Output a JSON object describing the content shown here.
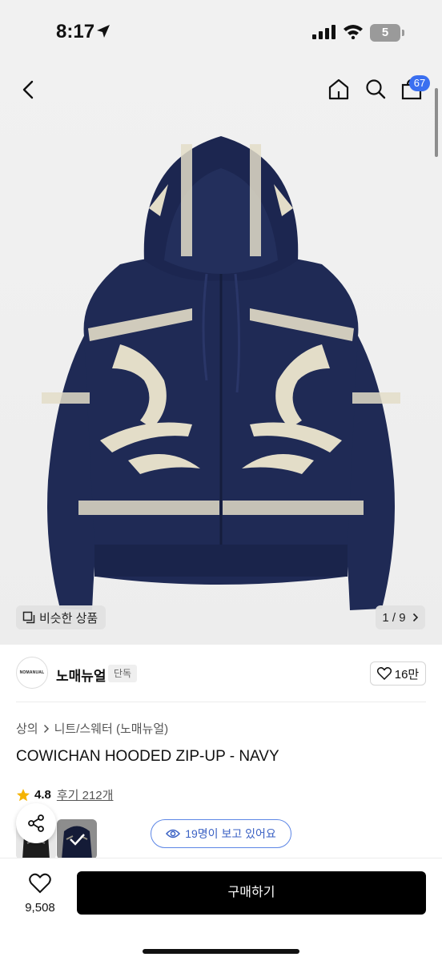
{
  "status_bar": {
    "time": "8:17",
    "battery": "5",
    "icons": [
      "location-arrow-icon",
      "signal-icon",
      "wifi-icon",
      "battery-icon"
    ]
  },
  "header": {
    "cart_count": "67",
    "icons": [
      "back-icon",
      "home-icon",
      "search-icon",
      "bag-icon"
    ]
  },
  "gallery": {
    "similar_label": "비슷한 상품",
    "page_current": "1",
    "page_total": "9",
    "page_text": "1 / 9",
    "colors": {
      "navy": "#1f2a55",
      "cream": "#e3ddc8"
    }
  },
  "brand": {
    "logo_text": "NOMANUAL",
    "name": "노매뉴얼",
    "tag": "단독",
    "likes": "16만"
  },
  "breadcrumb": {
    "category": "상의",
    "subcategory": "니트/스웨터 (노매뉴얼)"
  },
  "product": {
    "title": "COWICHAN HOODED ZIP-UP - NAVY",
    "rating": "4.8",
    "reviews": "후기 212개"
  },
  "viewers_text": "19명이 보고 있어요",
  "bottom": {
    "wish_count": "9,508",
    "buy_label": "구매하기"
  },
  "colors": {
    "accent_blue": "#3a6ff0",
    "star": "#f5b301",
    "buy_button": "#000000"
  }
}
